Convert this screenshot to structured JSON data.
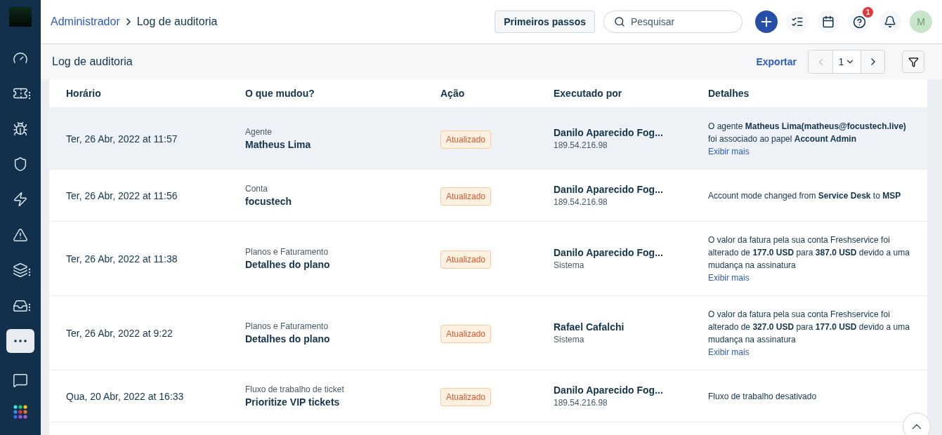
{
  "sidebar": {
    "items": [
      {
        "kind": "gauge",
        "selected": false,
        "has_menu": false
      },
      {
        "kind": "ticket",
        "selected": false,
        "has_menu": true
      },
      {
        "kind": "bug",
        "selected": false,
        "has_menu": false
      },
      {
        "kind": "shield",
        "selected": false,
        "has_menu": false
      },
      {
        "kind": "bolt",
        "selected": false,
        "has_menu": false
      },
      {
        "kind": "warning",
        "selected": false,
        "has_menu": false
      },
      {
        "kind": "layers",
        "selected": false,
        "has_menu": true
      },
      {
        "kind": "inbox",
        "selected": false,
        "has_menu": true
      },
      {
        "kind": "more",
        "selected": true,
        "has_menu": false
      },
      {
        "kind": "chat",
        "selected": false,
        "has_menu": false
      },
      {
        "kind": "apps",
        "selected": false,
        "has_menu": false
      }
    ]
  },
  "breadcrumb": {
    "parent": "Administrador",
    "current": "Log de auditoria"
  },
  "header": {
    "getting_started": "Primeiros passos",
    "search": {
      "placeholder": "Pesquisar"
    },
    "help_badge": "1",
    "avatar": "M"
  },
  "toolbar": {
    "title": "Log de auditoria",
    "export": "Exportar",
    "page": "1"
  },
  "table": {
    "columns": [
      "Horário",
      "O que mudou?",
      "Ação",
      "Executado por",
      "Detalhes"
    ],
    "rows": [
      {
        "highlighted": true,
        "time": "Ter, 26 Abr, 2022 at 11:57",
        "category": "Agente",
        "item": "Matheus Lima",
        "action": "Atualizado",
        "user": "Danilo Aparecido Fog...",
        "source": "189.54.216.98",
        "details": "O agente **Matheus Lima(matheus@focustech.live)** foi associado ao papel **Account Admin**",
        "more_link": "Exibir mais"
      },
      {
        "highlighted": false,
        "time": "Ter, 26 Abr, 2022 at 11:56",
        "category": "Conta",
        "item": "focustech",
        "action": "Atualizado",
        "user": "Danilo Aparecido Fog...",
        "source": "189.54.216.98",
        "details": "Account mode changed from **Service Desk** to **MSP**"
      },
      {
        "highlighted": false,
        "time": "Ter, 26 Abr, 2022 at 11:38",
        "category": "Planos e Faturamento",
        "item": "Detalhes do plano",
        "action": "Atualizado",
        "user": "Danilo Aparecido Fog...",
        "source": "Sistema",
        "details": "O valor da fatura pela sua conta Freshservice foi alterado de **177.0 USD** para **387.0 USD** devido a uma mudança na assinatura",
        "more_link": "Exibir mais"
      },
      {
        "highlighted": false,
        "time": "Ter, 26 Abr, 2022 at 9:22",
        "category": "Planos e Faturamento",
        "item": "Detalhes do plano",
        "action": "Atualizado",
        "user": "Rafael Cafalchi",
        "source": "Sistema",
        "details": "O valor da fatura pela sua conta Freshservice foi alterado de **327.0 USD** para **177.0 USD** devido a uma mudança na assinatura",
        "more_link": "Exibir mais"
      },
      {
        "highlighted": false,
        "time": "Qua, 20 Abr, 2022 at 16:33",
        "category": "Fluxo de trabalho de ticket",
        "item": "Prioritize VIP tickets",
        "action": "Atualizado",
        "user": "Danilo Aparecido Fog...",
        "source": "189.54.216.98",
        "details": "Fluxo de trabalho desativado"
      }
    ]
  }
}
